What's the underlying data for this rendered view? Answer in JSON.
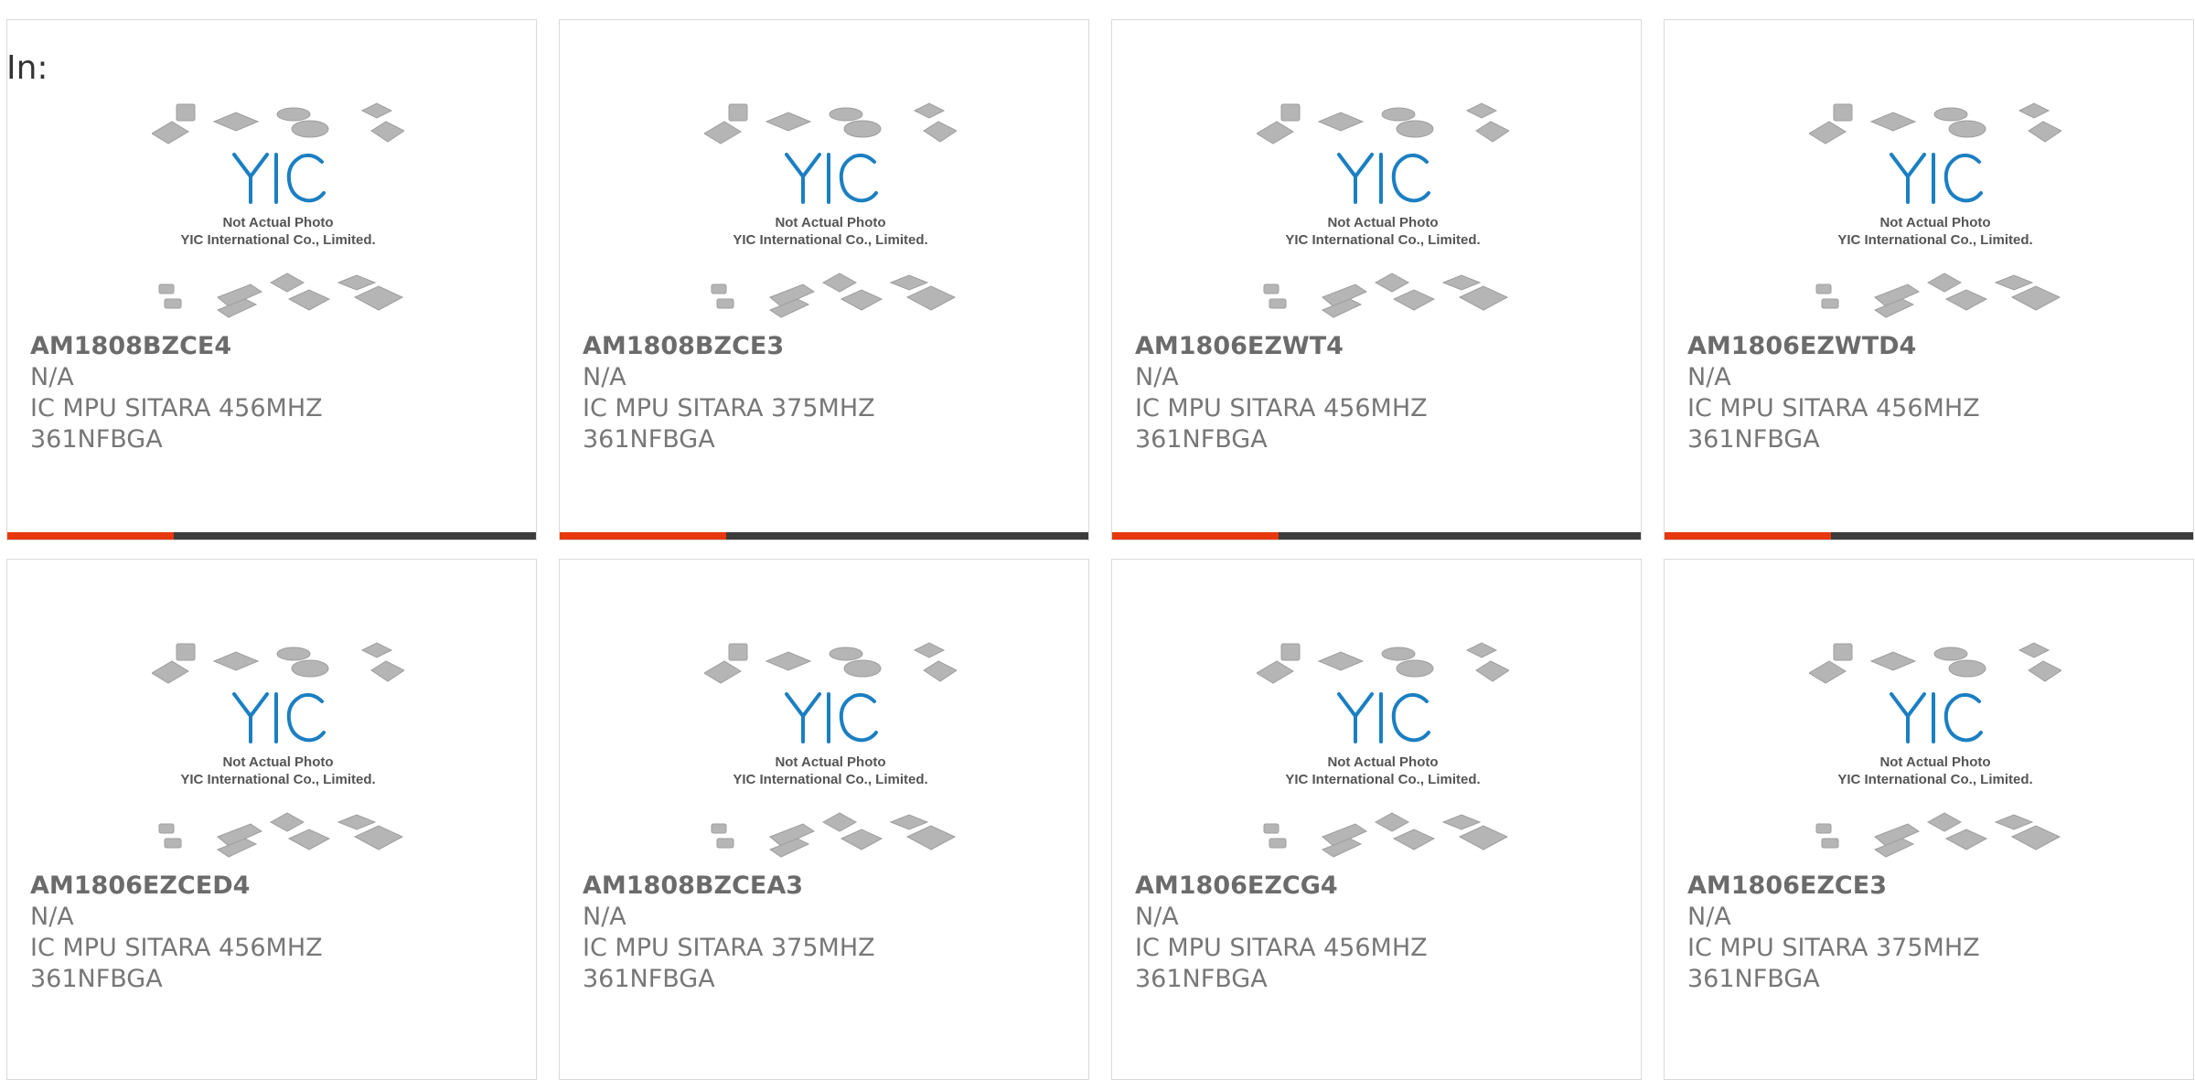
{
  "heading": "In:",
  "watermark": {
    "line1": "Not Actual Photo",
    "line2": "YIC International Co., Limited.",
    "logo_text": "YIC",
    "logo_color": "#1b7fc2"
  },
  "accent_color": "#e8380d",
  "products": [
    {
      "part": "AM1808BZCE4",
      "status": "N/A",
      "description": "IC MPU SITARA 456MHZ 361NFBGA"
    },
    {
      "part": "AM1808BZCE3",
      "status": "N/A",
      "description": "IC MPU SITARA 375MHZ 361NFBGA"
    },
    {
      "part": "AM1806EZWT4",
      "status": "N/A",
      "description": "IC MPU SITARA 456MHZ 361NFBGA"
    },
    {
      "part": "AM1806EZWTD4",
      "status": "N/A",
      "description": "IC MPU SITARA 456MHZ 361NFBGA"
    },
    {
      "part": "AM1806EZCED4",
      "status": "N/A",
      "description": "IC MPU SITARA 456MHZ 361NFBGA"
    },
    {
      "part": "AM1808BZCEA3",
      "status": "N/A",
      "description": "IC MPU SITARA 375MHZ 361NFBGA"
    },
    {
      "part": "AM1806EZCG4",
      "status": "N/A",
      "description": "IC MPU SITARA 456MHZ 361NFBGA"
    },
    {
      "part": "AM1806EZCE3",
      "status": "N/A",
      "description": "IC MPU SITARA 375MHZ 361NFBGA"
    }
  ]
}
